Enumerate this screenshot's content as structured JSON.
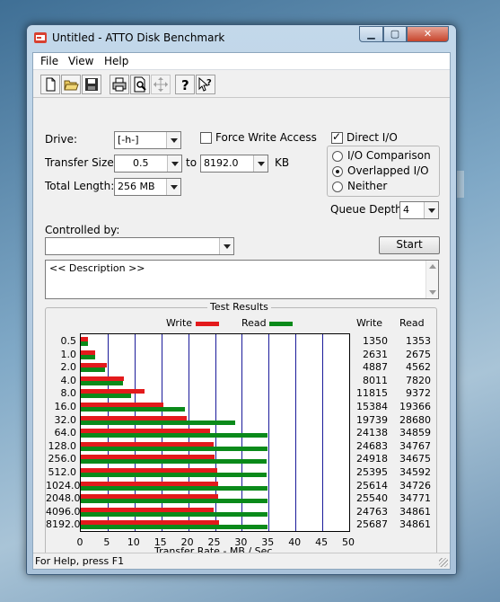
{
  "window": {
    "title": "Untitled - ATTO Disk Benchmark",
    "controls": {
      "minimize": "▁",
      "maximize": "▢",
      "close": "✕"
    }
  },
  "menu": [
    "File",
    "View",
    "Help"
  ],
  "toolbar": {
    "icons": [
      "new-file-icon",
      "open-folder-icon",
      "save-icon",
      "print-icon",
      "print-preview-icon",
      "move-icon",
      "help-icon",
      "context-help-icon"
    ]
  },
  "form": {
    "drive_label": "Drive:",
    "drive_value": "[-h-]",
    "force_write_label": "Force Write Access",
    "force_write_checked": false,
    "direct_io_label": "Direct I/O",
    "direct_io_checked": true,
    "transfer_size_label": "Transfer Size:",
    "transfer_from": "0.5",
    "to_label": "to",
    "transfer_to": "8192.0",
    "kb_label": "KB",
    "total_length_label": "Total Length:",
    "total_length_value": "256 MB",
    "io_options": [
      {
        "label": "I/O Comparison",
        "selected": false
      },
      {
        "label": "Overlapped I/O",
        "selected": true
      },
      {
        "label": "Neither",
        "selected": false
      }
    ],
    "queue_depth_label": "Queue Depth:",
    "queue_depth_value": "4",
    "controlled_by_label": "Controlled by:",
    "controlled_by_value": "",
    "start_button": "Start",
    "description": "<< Description >>"
  },
  "results": {
    "title": "Test Results",
    "legend_write": "Write",
    "legend_read": "Read",
    "col_write": "Write",
    "col_read": "Read",
    "write_color": "#e31a1c",
    "read_color": "#0a8a1a"
  },
  "chart_data": {
    "type": "bar",
    "orientation": "horizontal",
    "categories": [
      "0.5",
      "1.0",
      "2.0",
      "4.0",
      "8.0",
      "16.0",
      "32.0",
      "64.0",
      "128.0",
      "256.0",
      "512.0",
      "1024.0",
      "2048.0",
      "4096.0",
      "8192.0"
    ],
    "series": [
      {
        "name": "Write",
        "values": [
          1350,
          2631,
          4887,
          8011,
          11815,
          15384,
          19739,
          24138,
          24683,
          24918,
          25395,
          25614,
          25540,
          24763,
          25687
        ]
      },
      {
        "name": "Read",
        "values": [
          1353,
          2675,
          4562,
          7820,
          9372,
          19366,
          28680,
          34859,
          34767,
          34675,
          34592,
          34726,
          34771,
          34861,
          34861
        ]
      }
    ],
    "x_ticks": [
      "0",
      "5",
      "10",
      "15",
      "20",
      "25",
      "30",
      "35",
      "40",
      "45",
      "50"
    ],
    "xlim": [
      0,
      50
    ],
    "xlabel": "Transfer Rate - MB / Sec",
    "value_scale_note": "bar length in MB/s equals listed value divided by 1000",
    "grid": true,
    "legend": "top"
  },
  "status": {
    "text": "For Help, press F1"
  }
}
